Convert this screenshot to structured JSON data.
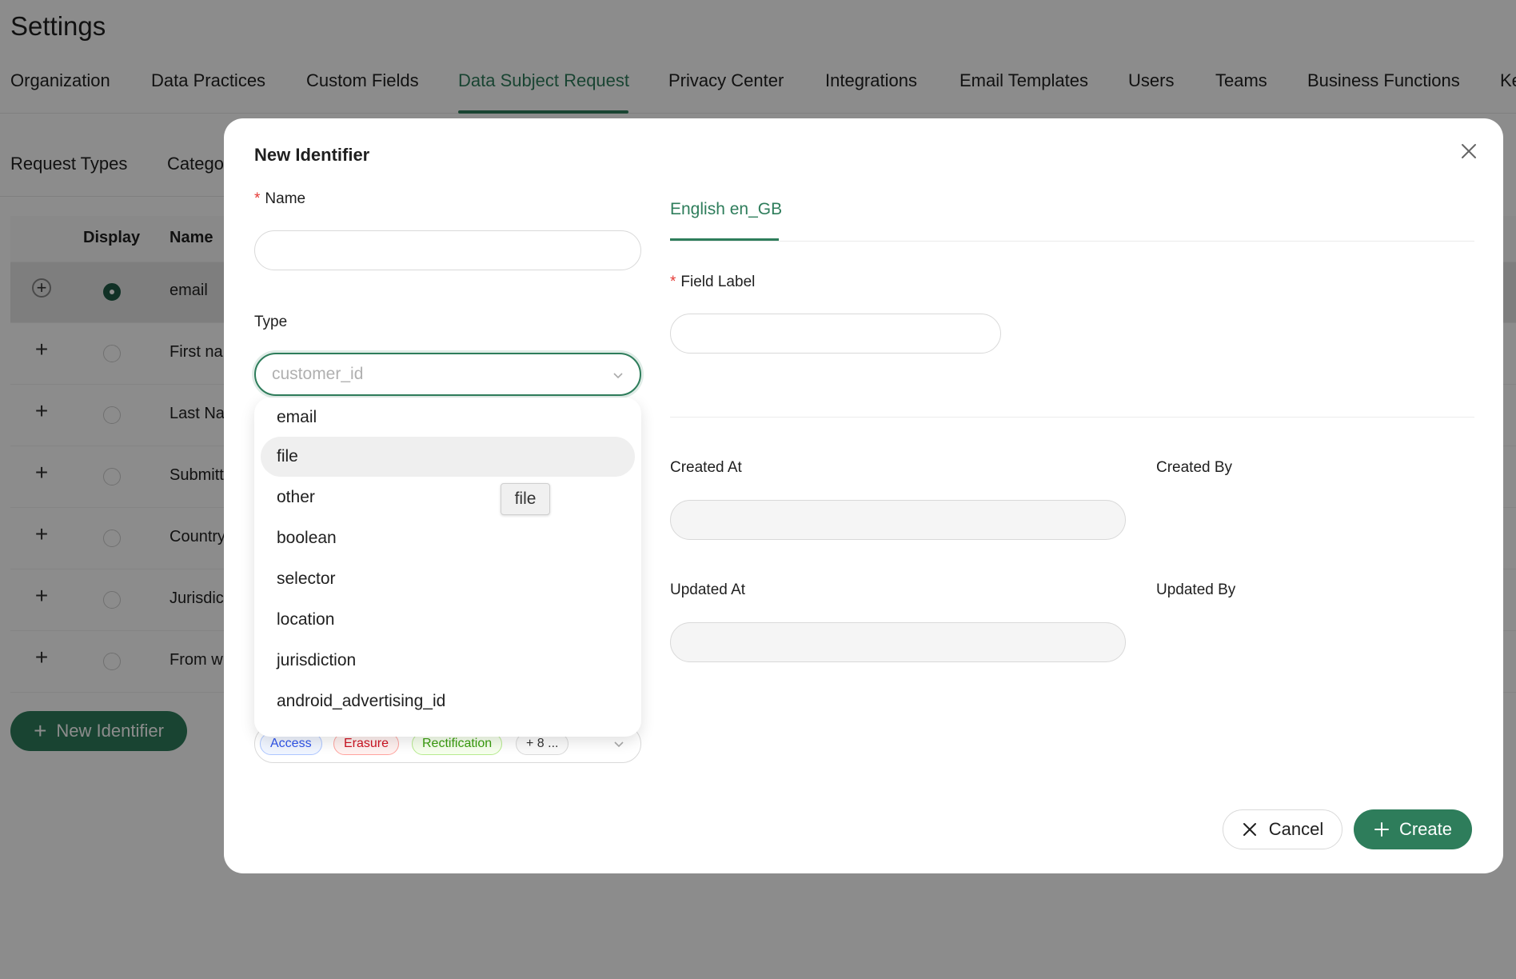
{
  "page": {
    "title": "Settings"
  },
  "tabs": [
    "Organization",
    "Data Practices",
    "Custom Fields",
    "Data Subject Request",
    "Privacy Center",
    "Integrations",
    "Email Templates",
    "Users",
    "Teams",
    "Business Functions",
    "Ke"
  ],
  "active_tab": "Data Subject Request",
  "subtabs": [
    "Request Types",
    "Catego"
  ],
  "table": {
    "headers": {
      "display": "Display",
      "name": "Name"
    },
    "rows": [
      {
        "name": "email",
        "display": true
      },
      {
        "name": "First na",
        "display": false
      },
      {
        "name": "Last Na",
        "display": false
      },
      {
        "name": "Submitt",
        "display": false
      },
      {
        "name": "Country",
        "display": false
      },
      {
        "name": "Jurisdic",
        "display": false
      },
      {
        "name": "From w",
        "display": false
      }
    ]
  },
  "new_identifier_button": "New Identifier",
  "modal": {
    "title": "New Identifier",
    "name_label": "Name",
    "name_value": "",
    "type_label": "Type",
    "type_placeholder": "customer_id",
    "locale_tab": "English en_GB",
    "field_label": "Field Label",
    "field_label_value": "",
    "created_at_label": "Created At",
    "created_by_label": "Created By",
    "updated_at_label": "Updated At",
    "updated_by_label": "Updated By",
    "request_type_chips": [
      "Access",
      "Erasure",
      "Rectification",
      "+ 8 ..."
    ],
    "cancel_label": "Cancel",
    "create_label": "Create"
  },
  "dropdown": {
    "options": [
      "email",
      "file",
      "other",
      "boolean",
      "selector",
      "location",
      "jurisdiction",
      "android_advertising_id"
    ],
    "hovered": "file"
  },
  "tooltip": "file",
  "colors": {
    "accent": "#2e7d5b",
    "required": "#e53935"
  }
}
